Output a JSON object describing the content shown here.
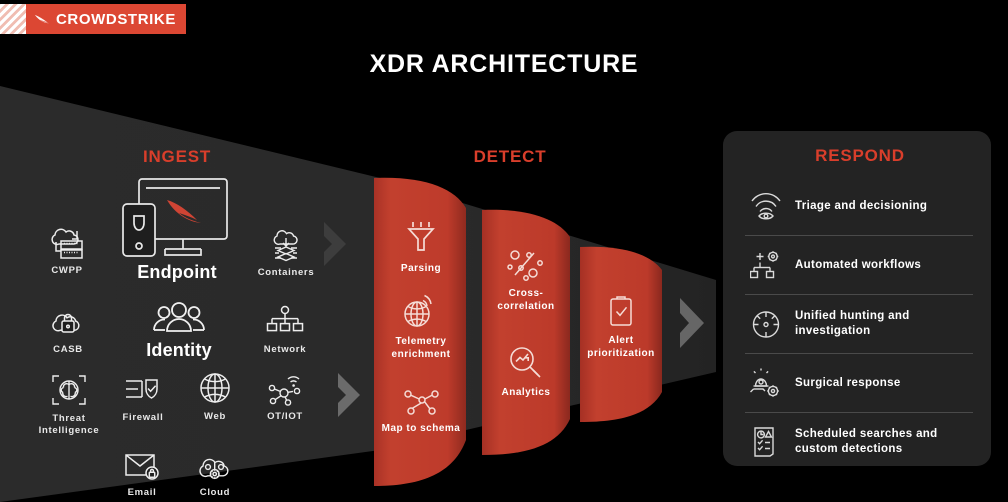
{
  "brand": {
    "logo_text": "CROWDSTRIKE",
    "logo_icon": "falcon-wing-icon",
    "accent_red": "#DC4733",
    "heading_red": "#D93E2B",
    "funnel_red": "#C03A2A",
    "panel_gray": "#232323",
    "background": "#000000"
  },
  "title": "XDR ARCHITECTURE",
  "sections": {
    "ingest": {
      "heading": "INGEST"
    },
    "detect": {
      "heading": "DETECT"
    },
    "respond": {
      "heading": "RESPOND"
    }
  },
  "ingest_items": [
    {
      "label": "CWPP",
      "icon": "cloud-server-icon"
    },
    {
      "label": "Endpoint",
      "icon": "desktop-mobile-falcon-icon"
    },
    {
      "label": "Containers",
      "icon": "cloud-containers-icon"
    },
    {
      "label": "CASB",
      "icon": "cloud-lock-icon"
    },
    {
      "label": "Identity",
      "icon": "users-group-icon"
    },
    {
      "label": "Network",
      "icon": "network-tree-icon"
    },
    {
      "label": "Threat Intelligence",
      "icon": "brain-scan-icon"
    },
    {
      "label": "Firewall",
      "icon": "firewall-shield-icon"
    },
    {
      "label": "Web",
      "icon": "globe-icon"
    },
    {
      "label": "OT/IOT",
      "icon": "iot-nodes-wifi-icon"
    },
    {
      "label": "Email",
      "icon": "email-lock-icon"
    },
    {
      "label": "Cloud",
      "icon": "cloud-gear-icon"
    }
  ],
  "funnels": [
    {
      "items": [
        {
          "label": "Parsing",
          "icon": "funnel-icon"
        },
        {
          "label": "Telemetry enrichment",
          "icon": "globe-signal-icon"
        },
        {
          "label": "Map to schema",
          "icon": "node-map-icon"
        }
      ]
    },
    {
      "items": [
        {
          "label": "Cross-correlation",
          "icon": "percent-scatter-icon"
        },
        {
          "label": "Analytics",
          "icon": "magnifier-chart-icon"
        }
      ]
    },
    {
      "items": [
        {
          "label": "Alert prioritization",
          "icon": "clipboard-check-icon"
        }
      ]
    }
  ],
  "respond_items": [
    {
      "label": "Triage and decisioning",
      "icon": "signal-eye-icon"
    },
    {
      "label": "Automated workflows",
      "icon": "workflow-gear-icon"
    },
    {
      "label": "Unified hunting and investigation",
      "icon": "crosshair-icon"
    },
    {
      "label": "Surgical response",
      "icon": "siren-gear-icon"
    },
    {
      "label": "Scheduled searches and custom detections",
      "icon": "document-checklist-icon"
    }
  ],
  "flow_arrows": [
    {
      "name": "arrow-ingest-row1"
    },
    {
      "name": "arrow-ingest-row2"
    },
    {
      "name": "arrow-detect-to-respond"
    }
  ]
}
